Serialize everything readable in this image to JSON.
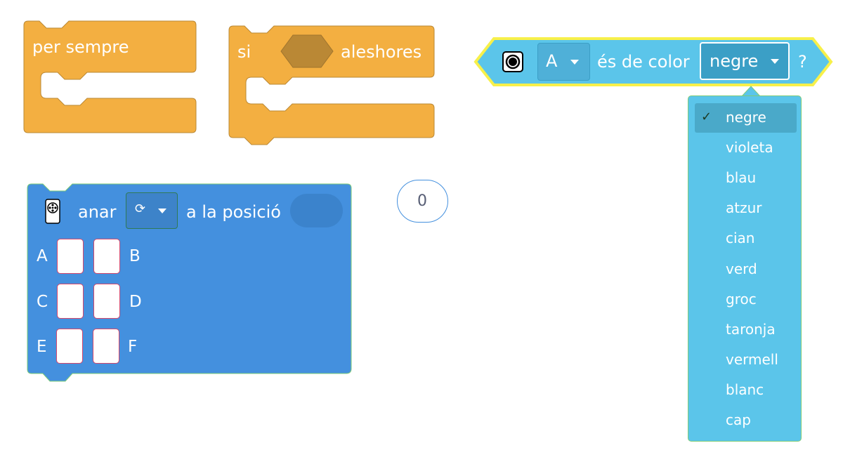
{
  "blocks": {
    "forever": {
      "label": "per sempre"
    },
    "if_then": {
      "if_label": "si",
      "then_label": "aleshores"
    },
    "color_sensor": {
      "port_value": "A",
      "middle_label": "és de color",
      "color_value": "negre",
      "question_mark": "?"
    },
    "motor_position": {
      "label_go": "anar",
      "direction_value": "⟳",
      "label_to_position": "a la posició",
      "ports": [
        "A",
        "B",
        "C",
        "D",
        "E",
        "F"
      ]
    },
    "number_reporter": {
      "value": "0"
    }
  },
  "color_menu": {
    "selected": "negre",
    "check_mark": "✓",
    "options": [
      "negre",
      "violeta",
      "blau",
      "atzur",
      "cian",
      "verd",
      "groc",
      "taronja",
      "vermell",
      "blanc",
      "cap"
    ]
  },
  "colors": {
    "control_orange": "#f3af41",
    "control_dark": "#ba8835",
    "sensor_blue": "#5bc5ea",
    "sensor_dark": "#3b9fc6",
    "motor_blue": "#4490de",
    "highlight_yellow": "#f7f04a"
  }
}
